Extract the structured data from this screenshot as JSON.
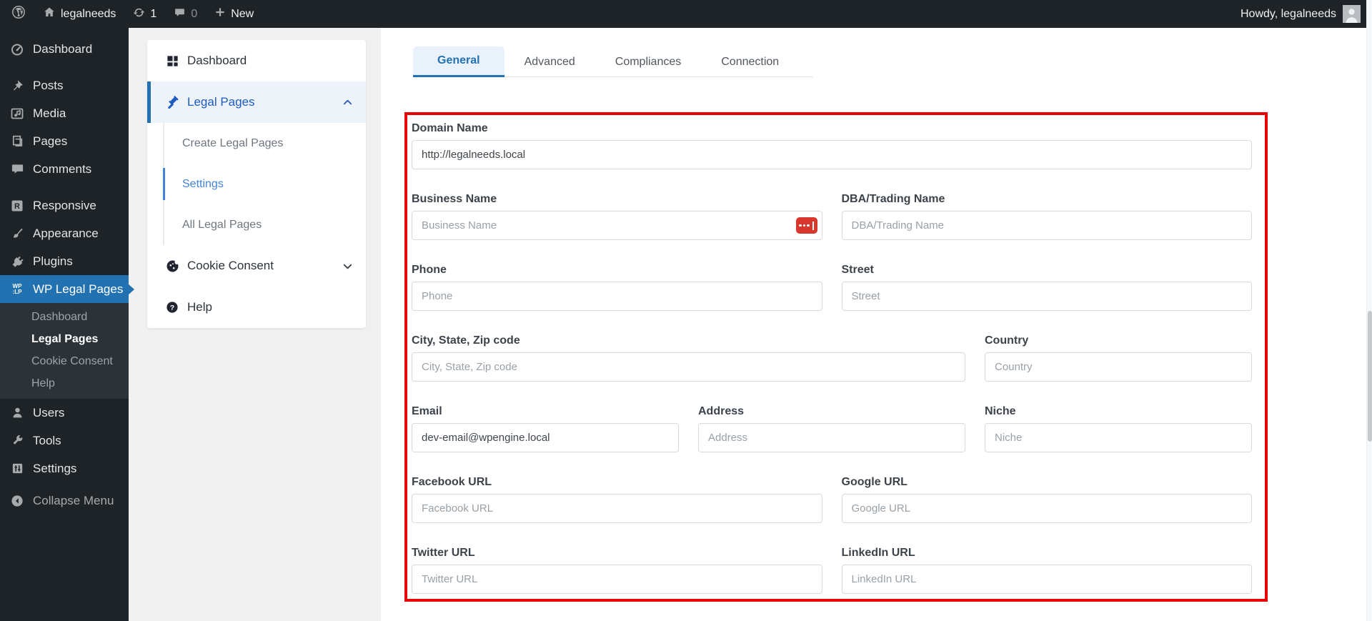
{
  "admin_bar": {
    "site_name": "legalneeds",
    "update_count": "1",
    "comment_count": "0",
    "new_label": "New",
    "howdy_text": "Howdy, legalneeds"
  },
  "admin_menu": {
    "items": [
      {
        "label": "Dashboard"
      },
      {
        "label": "Posts"
      },
      {
        "label": "Media"
      },
      {
        "label": "Pages"
      },
      {
        "label": "Comments"
      },
      {
        "label": "Responsive"
      },
      {
        "label": "Appearance"
      },
      {
        "label": "Plugins"
      },
      {
        "label": "WP Legal Pages"
      },
      {
        "label": "Users"
      },
      {
        "label": "Tools"
      },
      {
        "label": "Settings"
      },
      {
        "label": "Collapse Menu"
      }
    ],
    "wp_legal_pages_submenu": [
      {
        "label": "Dashboard"
      },
      {
        "label": "Legal Pages"
      },
      {
        "label": "Cookie Consent"
      },
      {
        "label": "Help"
      }
    ]
  },
  "plugin_nav": {
    "dashboard": "Dashboard",
    "legal_pages": "Legal Pages",
    "create_legal_pages": "Create Legal Pages",
    "settings": "Settings",
    "all_legal_pages": "All Legal Pages",
    "cookie_consent": "Cookie Consent",
    "help": "Help"
  },
  "tabs": [
    {
      "label": "General"
    },
    {
      "label": "Advanced"
    },
    {
      "label": "Compliances"
    },
    {
      "label": "Connection"
    }
  ],
  "form": {
    "fields": [
      {
        "label": "Domain Name",
        "value": "http://legalneeds.local"
      },
      {
        "label": "Business Name",
        "placeholder": "Business Name"
      },
      {
        "label": "DBA/Trading Name",
        "placeholder": "DBA/Trading Name"
      },
      {
        "label": "Phone",
        "placeholder": "Phone"
      },
      {
        "label": "Street",
        "placeholder": "Street"
      },
      {
        "label": "City, State, Zip code",
        "placeholder": "City, State, Zip code"
      },
      {
        "label": "Country",
        "placeholder": "Country"
      },
      {
        "label": "Email",
        "value": "dev-email@wpengine.local"
      },
      {
        "label": "Address",
        "placeholder": "Address"
      },
      {
        "label": "Niche",
        "placeholder": "Niche"
      },
      {
        "label": "Facebook URL",
        "placeholder": "Facebook URL"
      },
      {
        "label": "Google URL",
        "placeholder": "Google URL"
      },
      {
        "label": "Twitter URL",
        "placeholder": "Twitter URL"
      },
      {
        "label": "LinkedIn URL",
        "placeholder": "LinkedIn URL"
      }
    ]
  },
  "colors": {
    "accent_blue": "#2271b1",
    "highlight_red": "#e90000",
    "admin_dark": "#1d2327"
  }
}
